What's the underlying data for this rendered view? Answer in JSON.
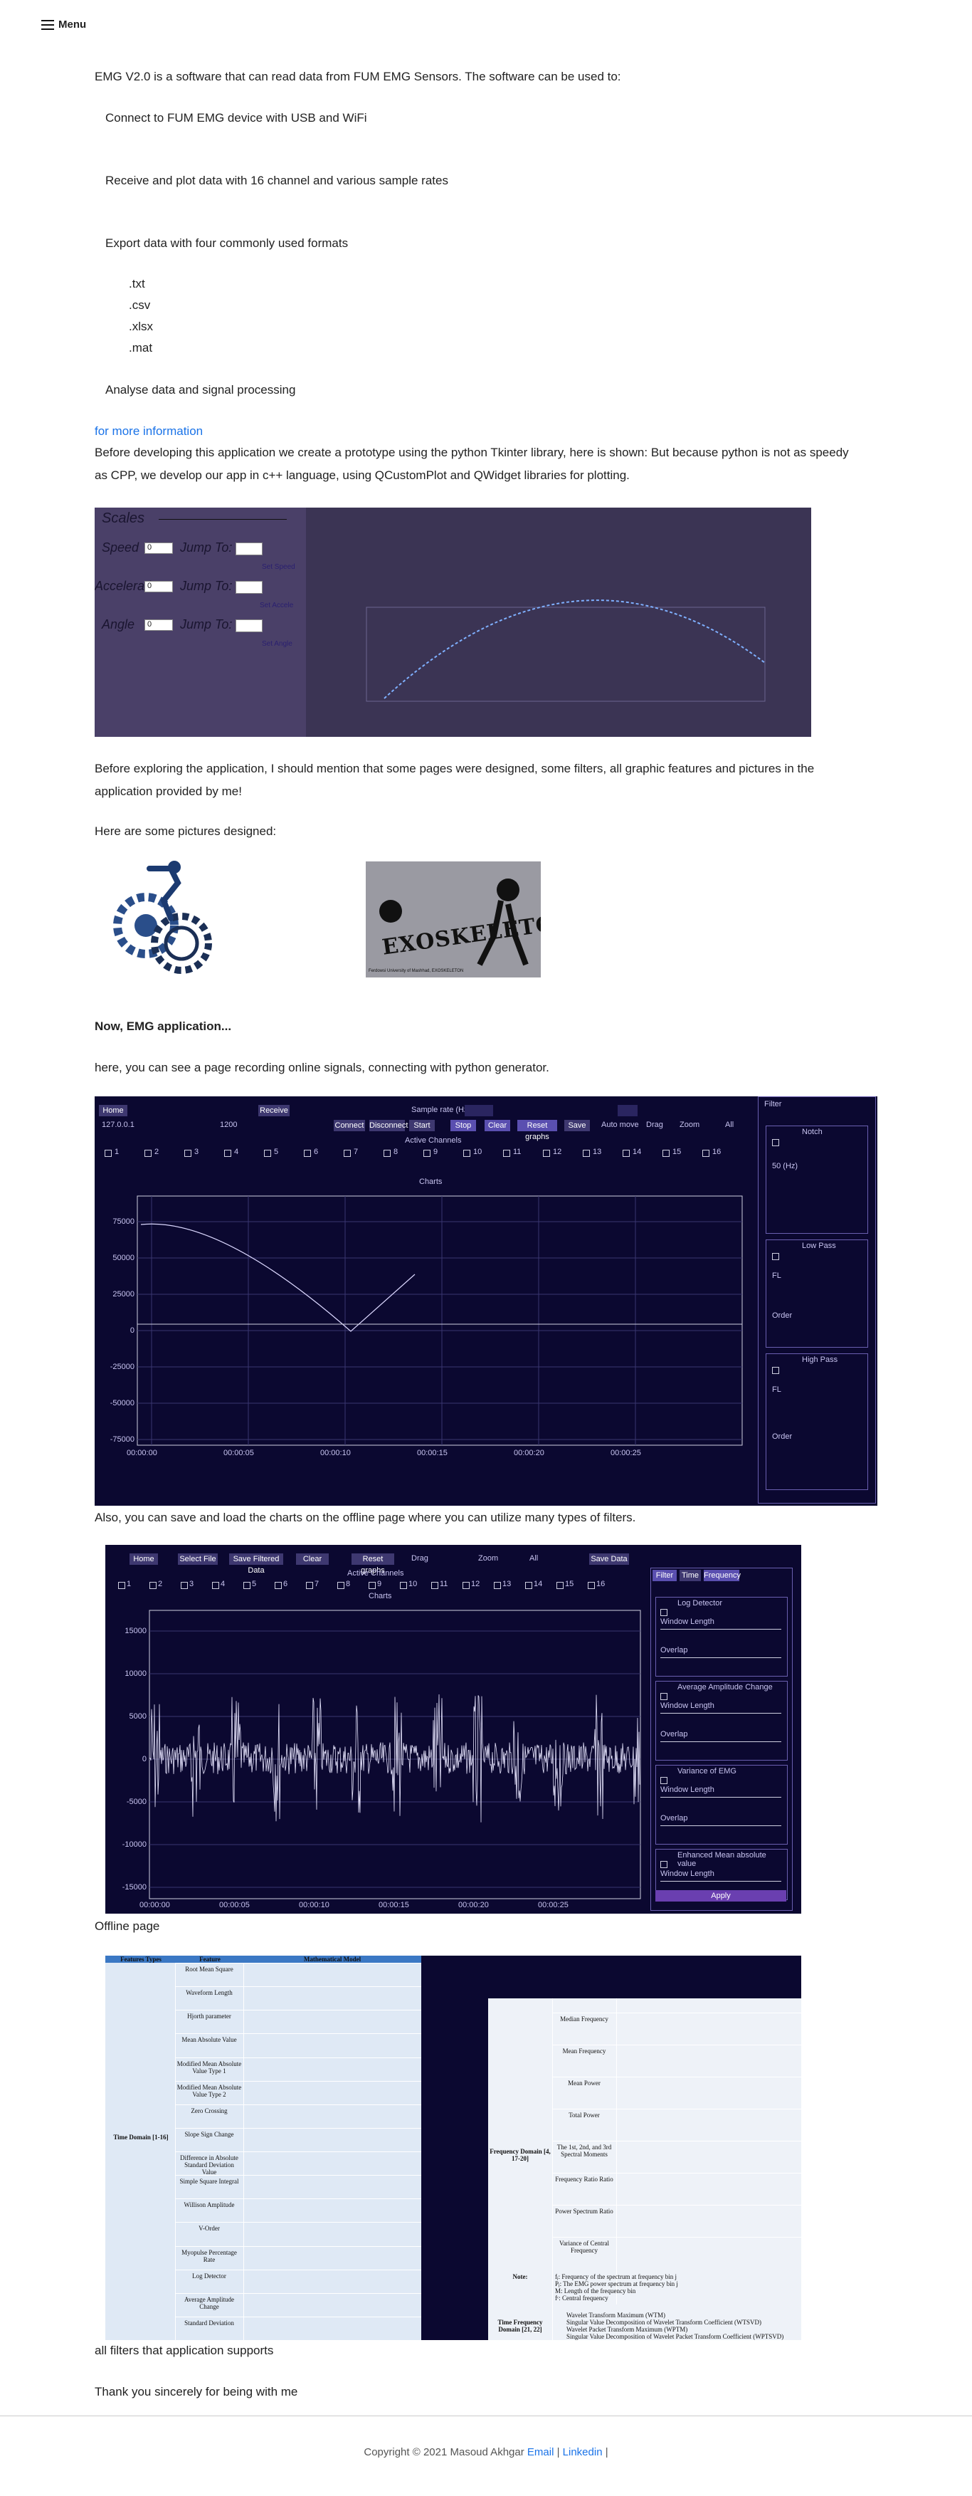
{
  "nav": {
    "menu_label": "Menu"
  },
  "intro": {
    "lead": "EMG V2.0 is a software that can read data from FUM EMG Sensors. The software can be used to:",
    "features": [
      "Connect to FUM EMG device with USB and WiFi",
      "Receive and plot data with 16 channel and various sample rates",
      "Export data with four commonly used formats",
      "Analyse data and signal processing"
    ],
    "formats": [
      ".txt",
      ".csv",
      ".xlsx",
      ".mat"
    ],
    "more_link": "for more information",
    "before_dev": "Before developing this application we create a prototype using the python Tkinter library, here is shown: But because python is not as speedy as CPP, we develop our app in c++ language, using QCustomPlot and QWidget libraries for plotting.",
    "before_explore": "Before exploring the application, I should mention that some pages were designed, some filters, all graphic features and pictures in the application provided by me!",
    "pictures_intro": "Here are some pictures designed:",
    "app_heading": "Now, EMG application...",
    "online_text": "here, you can see a page recording online signals, connecting with python generator.",
    "offline_text": "Also, you can save and load the charts on the offline page where you can utilize many types of filters.",
    "offline_caption": "Offline page",
    "filters_caption": "all filters that application supports",
    "thanks": "Thank you sincerely for being with me"
  },
  "tkinter_shot": {
    "title": "Scales",
    "rows": [
      {
        "label": "Speed",
        "value": "0",
        "jump": "Jump To:",
        "set": "Set Speed"
      },
      {
        "label": "Acceleration",
        "value": "0",
        "jump": "Jump To:",
        "set": "Set Accele"
      },
      {
        "label": "Angle",
        "value": "0",
        "jump": "Jump To:",
        "set": "Set Angle"
      }
    ]
  },
  "designed_pictures": {
    "exoskeleton_logo": "EXOSKELETON",
    "exoskeleton_sub": "Ferdowsi University of Mashhad, EXOSKELETON"
  },
  "online_page": {
    "home": "Home",
    "receive": "Receive",
    "sample_rate_label": "Sample rate (Hz):",
    "sample_rate_value": "",
    "ip": "127.0.0.1",
    "port": "1200",
    "connect": "Connect",
    "disconnect": "Disconnect",
    "start": "Start",
    "stop": "Stop",
    "clear": "Clear",
    "reset_graphs": "Reset graphs",
    "save": "Save",
    "auto_move": "Auto move",
    "drag": "Drag",
    "zoom": "Zoom",
    "all": "All",
    "active_channels": "Active Channels",
    "chart_title": "Charts",
    "channels": [
      "1",
      "2",
      "3",
      "4",
      "5",
      "6",
      "7",
      "8",
      "9",
      "10",
      "11",
      "12",
      "13",
      "14",
      "15",
      "16"
    ],
    "y_ticks": [
      "75000",
      "50000",
      "25000",
      "0",
      "-25000",
      "-50000",
      "-75000"
    ],
    "x_ticks": [
      "00:00:00",
      "00:00:05",
      "00:00:10",
      "00:00:15",
      "00:00:20",
      "00:00:25"
    ],
    "filter_title": "Filter",
    "notch": "Notch",
    "notch_value": "50 (Hz)",
    "low_pass": "Low Pass",
    "high_pass": "High Pass",
    "fl": "FL",
    "order": "Order"
  },
  "offline_page": {
    "home": "Home",
    "select_file": "Select File",
    "save_filtered": "Save Filtered Data",
    "clear": "Clear",
    "reset_graphs": "Reset graphs",
    "drag": "Drag",
    "zoom": "Zoom",
    "all": "All",
    "save_data": "Save Data",
    "active_channels": "Active Channels",
    "chart_title": "Charts",
    "tabs": [
      "Filter",
      "Time",
      "Frequency"
    ],
    "y_ticks": [
      "15000",
      "10000",
      "5000",
      "0",
      "-5000",
      "-10000",
      "-15000"
    ],
    "x_ticks": [
      "00:00:00",
      "00:00:05",
      "00:00:10",
      "00:00:15",
      "00:00:20",
      "00:00:25"
    ],
    "groups": [
      {
        "title": "Log Detector",
        "fields": [
          "Window Length",
          "Overlap"
        ]
      },
      {
        "title": "Average Amplitude Change",
        "fields": [
          "Window Length",
          "Overlap"
        ]
      },
      {
        "title": "Variance of EMG",
        "fields": [
          "Window Length",
          "Overlap"
        ]
      },
      {
        "title": "Enhanced Mean absolute value",
        "fields": [
          "Window Length"
        ]
      }
    ],
    "apply": "Apply"
  },
  "features_table": {
    "headers": [
      "Features Types",
      "Feature",
      "Mathematical Model"
    ],
    "time_domain": "Time Domain [1-16]",
    "time_features": [
      "Root Mean Square",
      "Waveform Length",
      "Hjorth parameter",
      "Mean Absolute Value",
      "Modified Mean Absolute Value Type 1",
      "Modified Mean Absolute Value Type 2",
      "Zero Crossing",
      "Slope Sign Change",
      "Difference in Absolute Standard Deviation Value",
      "Simple Square Integral",
      "Willison Amplitude",
      "V-Order",
      "Myopulse Percentage Rate",
      "Log Detector",
      "Average Amplitude Change",
      "Standard Deviation"
    ],
    "freq_domain": "Frequency Domain [4, 17-20]",
    "freq_features": [
      "Median Frequency",
      "Mean Frequency",
      "Mean Power",
      "Total Power",
      "The 1st, 2nd, and 3rd Spectral Moments",
      "Frequency Ratio Ratio",
      "Power Spectrum Ratio",
      "Variance of Central Frequency"
    ],
    "note_label": "Note:",
    "notes": [
      "fⱼ: Frequency of the spectrum at frequency bin j",
      "Pⱼ: The EMG power spectrum at frequency bin j",
      "M: Length of the frequency bin",
      "fᶜ: Central frequency"
    ],
    "tf_domain": "Time Frequency Domain [21, 22]",
    "tf_features": [
      "Wavelet Transform Maximum (WTM)",
      "Singular Value Decomposition of Wavelet Transform Coefficient (WTSVD)",
      "Wavelet Packet Transform Maximum (WPTM)",
      "Singular Value Decomposition of Wavelet Packet Transform Coefficient (WPTSVD)"
    ]
  },
  "footer": {
    "copyright": "Copyright © 2021 Masoud Akhgar",
    "email": "Email",
    "linkedin": "Linkedin",
    "sep": "|"
  }
}
